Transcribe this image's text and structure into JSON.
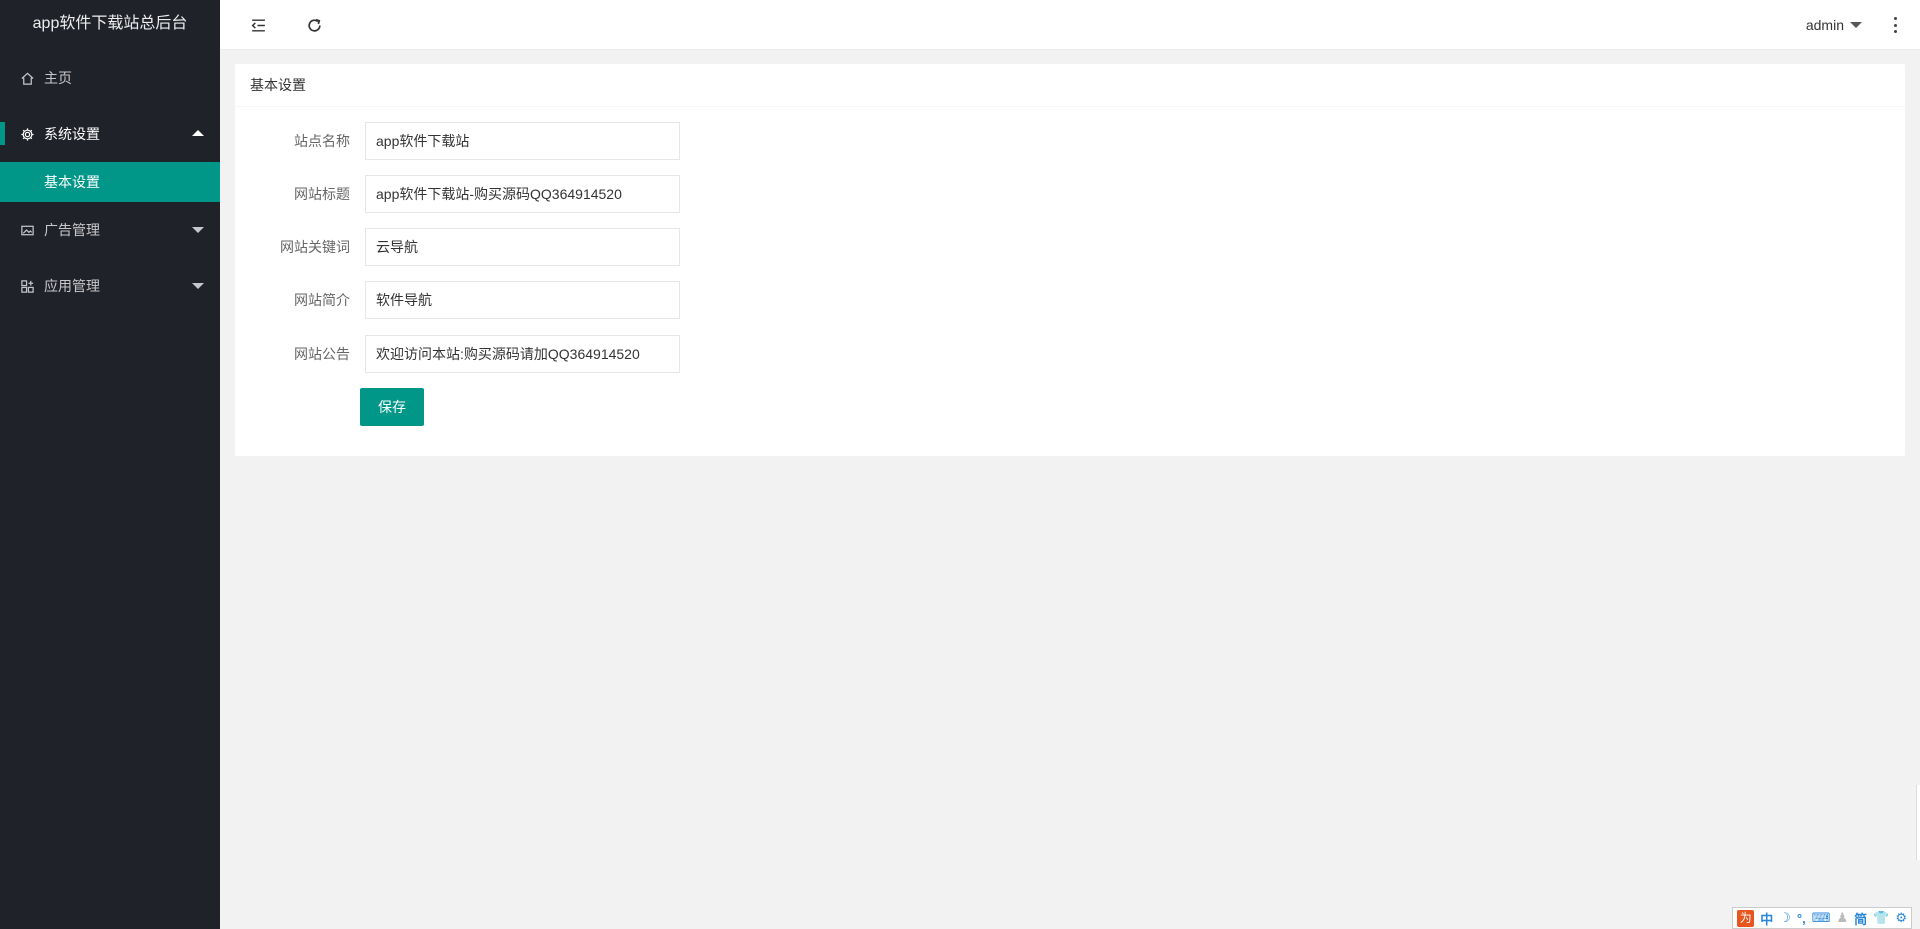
{
  "app": {
    "title": "app软件下载站总后台"
  },
  "sidebar": {
    "items": [
      {
        "label": "主页",
        "icon": "home-icon"
      },
      {
        "label": "系统设置",
        "icon": "gear-icon",
        "open": true,
        "children": [
          {
            "label": "基本设置",
            "active": true
          }
        ]
      },
      {
        "label": "广告管理",
        "icon": "image-icon"
      },
      {
        "label": "应用管理",
        "icon": "apps-icon"
      }
    ]
  },
  "header": {
    "user": "admin",
    "icons": [
      "menu-collapse-icon",
      "refresh-icon",
      "more-vertical-icon"
    ]
  },
  "card": {
    "title": "基本设置"
  },
  "form": {
    "fields": [
      {
        "label": "站点名称",
        "value": "app软件下载站"
      },
      {
        "label": "网站标题",
        "value": "app软件下载站-购买源码QQ364914520"
      },
      {
        "label": "网站关键词",
        "value": "云导航"
      },
      {
        "label": "网站简介",
        "value": "软件导航"
      },
      {
        "label": "网站公告",
        "value": "欢迎访问本站:购买源码请加QQ364914520"
      }
    ],
    "save_label": "保存"
  },
  "ime": {
    "logo": "为",
    "items": [
      "中",
      "☽",
      "°,",
      "⌨",
      "♟",
      "简",
      "👕",
      "⚙"
    ]
  },
  "colors": {
    "sidebar_bg": "#20222a",
    "accent": "#009688",
    "page_bg": "#f2f2f2"
  }
}
